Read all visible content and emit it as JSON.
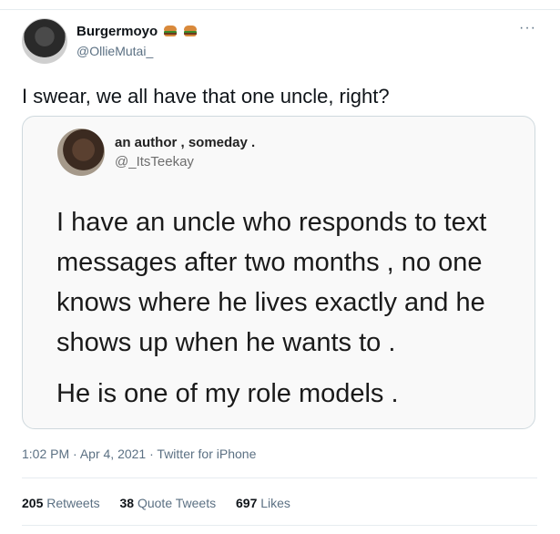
{
  "author": {
    "name": "Burgermoyo",
    "handle": "@OllieMutai_"
  },
  "more_label": "···",
  "tweet": {
    "text": "I swear, we all have that one uncle, right?"
  },
  "quoted": {
    "name": "an author , someday .",
    "handle": "@_ItsTeekay",
    "paragraph1": "I have an uncle who responds to text messages after two months , no one knows where he lives exactly and he shows up when he wants to .",
    "paragraph2": "He is one of my role models ."
  },
  "meta": {
    "time": "1:02 PM",
    "date": "Apr 4, 2021",
    "source": "Twitter for iPhone",
    "separator": "·"
  },
  "stats": {
    "retweets": {
      "count": "205",
      "label": "Retweets"
    },
    "quotes": {
      "count": "38",
      "label": "Quote Tweets"
    },
    "likes": {
      "count": "697",
      "label": "Likes"
    }
  }
}
